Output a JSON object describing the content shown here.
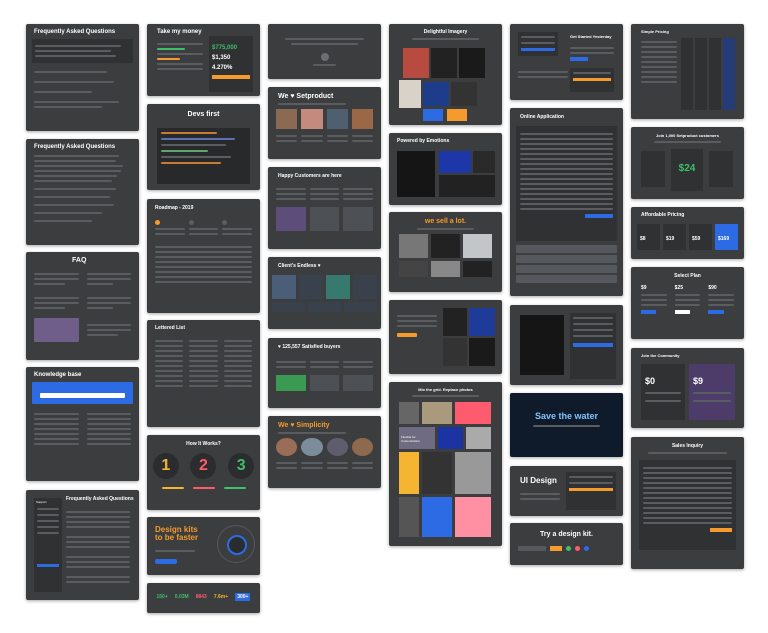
{
  "faq1": {
    "title": "Frequently Asked Questions"
  },
  "faq2": {
    "title": "Frequently Asked Questions"
  },
  "faq3": {
    "title": "FAQ"
  },
  "knowledge": {
    "title": "Knowledge base"
  },
  "support": {
    "title": "Frequently Asked Questions",
    "sidebar_label": "Support"
  },
  "money": {
    "title": "Take my money",
    "values": [
      "$775,000",
      "$1,350",
      "4.270%"
    ]
  },
  "devs": {
    "title": "Devs first"
  },
  "roadmap": {
    "title": "Roadmap - 2019"
  },
  "lettered": {
    "title": "Lettered List"
  },
  "how": {
    "title": "How It Works?",
    "steps": [
      "1",
      "2",
      "3"
    ]
  },
  "design_kits": {
    "title_line1": "Design kits",
    "title_line2": "to be faster"
  },
  "stats": {
    "items": [
      "150+",
      "0.03M",
      "8843",
      "7.6m+",
      "300+"
    ]
  },
  "setproduct": {
    "title": "We ♥ Setproduct"
  },
  "happy": {
    "title": "Happy Customers are here"
  },
  "endless": {
    "title": "Client's Endless ♥"
  },
  "satisfied": {
    "title": "♥ 125,557 Satisfied buyers"
  },
  "simplicity": {
    "title": "We ♥ Simplicity"
  },
  "delightful": {
    "title": "Delightful Imagery"
  },
  "emotions": {
    "title": "Powered by Emotions"
  },
  "sell": {
    "title": "we sell a lot."
  },
  "grid": {
    "title": "Mix the grid. Replace photos",
    "caption": "Flexible for Customization"
  },
  "signup": {
    "title": "Get Started Yesterday"
  },
  "online": {
    "title": "Online Application"
  },
  "water": {
    "title": "Save the water"
  },
  "uidesign": {
    "title": "UI Design"
  },
  "trykit": {
    "title": "Try a design kit."
  },
  "pricing1": {
    "title": "Simple Pricing"
  },
  "join": {
    "title": "Join 1,000 Setproduct customers",
    "price": "$24"
  },
  "affordable": {
    "title": "Affordable Pricing",
    "prices": [
      "$8",
      "$19",
      "$59",
      "$169"
    ]
  },
  "plan": {
    "title": "Select Plan",
    "prices": [
      "$9",
      "$25",
      "$90"
    ]
  },
  "community": {
    "title": "Join the Community",
    "prices": [
      "$0",
      "$9"
    ]
  },
  "sales": {
    "title": "Sales Inquiry"
  }
}
